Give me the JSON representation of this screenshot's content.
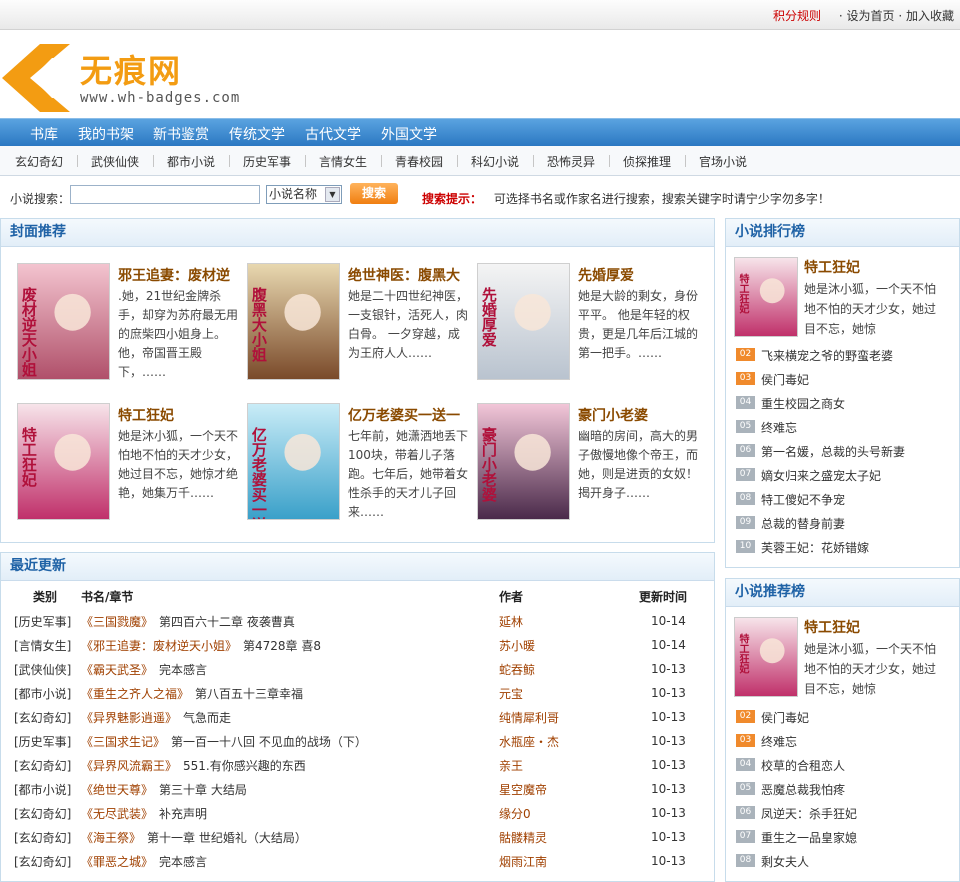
{
  "topbar": {
    "score_rules": "积分规则",
    "set_home": "· 设为首页",
    "bookmark": "· 加入收藏"
  },
  "logo": {
    "name": "无痕网",
    "url": "www.wh-badges.com"
  },
  "main_nav": [
    "书库",
    "我的书架",
    "新书鉴赏",
    "传统文学",
    "古代文学",
    "外国文学"
  ],
  "sub_nav": [
    "玄幻奇幻",
    "武侠仙侠",
    "都市小说",
    "历史军事",
    "言情女生",
    "青春校园",
    "科幻小说",
    "恐怖灵异",
    "侦探推理",
    "官场小说"
  ],
  "search": {
    "label": "小说搜索：",
    "select_value": "小说名称",
    "button": "搜索",
    "tip_title": "搜索提示：",
    "tip": "可选择书名或作家名进行搜索，搜索关键字时请宁少字勿多字！"
  },
  "cover_panel": {
    "title": "封面推荐",
    "books": [
      {
        "title": "邪王追妻：废材逆",
        "desc": ".她，21世纪金牌杀手，却穿为苏府最无用的庶柴四小姐身上。他，帝国晋王殿下，……",
        "colors": [
          "#f3c4cf",
          "#b0506a"
        ],
        "cover_text": "废材逆天小姐"
      },
      {
        "title": "绝世神医：腹黑大",
        "desc": "她是二十四世纪神医，一支银针，活死人，肉白骨。 一夕穿越，成为王府人人……",
        "colors": [
          "#e8d8b0",
          "#7a4a2a"
        ],
        "cover_text": "腹黑大小姐"
      },
      {
        "title": "先婚厚爱",
        "desc": "她是大龄的剩女，身份平平。 他是年轻的权贵，更是几年后江城的第一把手。……",
        "colors": [
          "#f4f4f4",
          "#b9c3cf"
        ],
        "cover_text": "先婚厚爱"
      },
      {
        "title": "特工狂妃",
        "desc": "她是沐小狐，一个天不怕地不怕的天才少女，她过目不忘，她惊才绝艳，她集万千……",
        "colors": [
          "#f7e4ea",
          "#c0306a"
        ],
        "cover_text": "特工狂妃"
      },
      {
        "title": "亿万老婆买一送一",
        "desc": "七年前，她潇洒地丢下100块，带着儿子落跑。七年后，她带着女性杀手的天才儿子回来……",
        "colors": [
          "#c9ecf7",
          "#3aa0c9"
        ],
        "cover_text": "亿万老婆买一送一"
      },
      {
        "title": "豪门小老婆",
        "desc": "幽暗的房间，高大的男子傲慢地像个帝王，而她，则是进贡的女奴！揭开身子……",
        "colors": [
          "#f2c6d8",
          "#4a2a4a"
        ],
        "cover_text": "豪门小老婆"
      }
    ]
  },
  "update_panel": {
    "title": "最近更新",
    "headers": {
      "cat": "类别",
      "book": "书名/章节",
      "author": "作者",
      "time": "更新时间"
    },
    "rows": [
      {
        "cat": "[历史军事]",
        "book": "《三国戮魔》",
        "chapter": "第四百六十二章 夜袭曹真",
        "author": "延林",
        "time": "10-14"
      },
      {
        "cat": "[言情女生]",
        "book": "《邪王追妻：废材逆天小姐》",
        "chapter": "第4728章 喜8",
        "author": "苏小暖",
        "time": "10-14"
      },
      {
        "cat": "[武侠仙侠]",
        "book": "《霸天武圣》",
        "chapter": "完本感言",
        "author": "蛇吞鲸",
        "time": "10-13"
      },
      {
        "cat": "[都市小说]",
        "book": "《重生之齐人之福》",
        "chapter": "第八百五十三章幸福",
        "author": "元宝",
        "time": "10-13"
      },
      {
        "cat": "[玄幻奇幻]",
        "book": "《异界魅影逍遥》",
        "chapter": "气急而走",
        "author": "纯情犀利哥",
        "time": "10-13"
      },
      {
        "cat": "[历史军事]",
        "book": "《三国求生记》",
        "chapter": "第一百一十八回 不见血的战场（下）",
        "author": "水瓶座・杰",
        "time": "10-13"
      },
      {
        "cat": "[玄幻奇幻]",
        "book": "《异界风流霸王》",
        "chapter": "551.有你感兴趣的东西",
        "author": "亲王",
        "time": "10-13"
      },
      {
        "cat": "[都市小说]",
        "book": "《绝世天尊》",
        "chapter": "第三十章 大结局",
        "author": "星空魔帝",
        "time": "10-13"
      },
      {
        "cat": "[玄幻奇幻]",
        "book": "《无尽武装》",
        "chapter": "补充声明",
        "author": "缘分0",
        "time": "10-13"
      },
      {
        "cat": "[玄幻奇幻]",
        "book": "《海王祭》",
        "chapter": "第十一章 世纪婚礼（大结局）",
        "author": "骷髅精灵",
        "time": "10-13"
      },
      {
        "cat": "[玄幻奇幻]",
        "book": "《罪恶之城》",
        "chapter": "完本感言",
        "author": "烟雨江南",
        "time": "10-13"
      }
    ]
  },
  "rank_panel": {
    "title": "小说排行榜",
    "featured": {
      "title": "特工狂妃",
      "desc": "她是沐小狐，一个天不怕地不怕的天才少女，她过目不忘，她惊",
      "cover_text": "特工狂妃"
    },
    "items": [
      {
        "num": "02",
        "name": "飞来横宠之爷的野蛮老婆"
      },
      {
        "num": "03",
        "name": "侯门毒妃"
      },
      {
        "num": "04",
        "name": "重生校园之商女"
      },
      {
        "num": "05",
        "name": "终难忘"
      },
      {
        "num": "06",
        "name": "第一名媛，总裁的头号新妻"
      },
      {
        "num": "07",
        "name": "嫡女归来之盛宠太子妃"
      },
      {
        "num": "08",
        "name": "特工傻妃不争宠"
      },
      {
        "num": "09",
        "name": "总裁的替身前妻"
      },
      {
        "num": "10",
        "name": "芙蓉王妃：花娇错嫁"
      }
    ]
  },
  "recommend_panel": {
    "title": "小说推荐榜",
    "featured": {
      "title": "特工狂妃",
      "desc": "她是沐小狐，一个天不怕地不怕的天才少女，她过目不忘，她惊",
      "cover_text": "特工狂妃"
    },
    "items": [
      {
        "num": "02",
        "name": "侯门毒妃"
      },
      {
        "num": "03",
        "name": "终难忘"
      },
      {
        "num": "04",
        "name": "校草的合租恋人"
      },
      {
        "num": "05",
        "name": "恶魔总裁我怕疼"
      },
      {
        "num": "06",
        "name": "凤逆天：杀手狂妃"
      },
      {
        "num": "07",
        "name": "重生之一品皇家媳"
      },
      {
        "num": "08",
        "name": "剩女夫人"
      }
    ]
  }
}
